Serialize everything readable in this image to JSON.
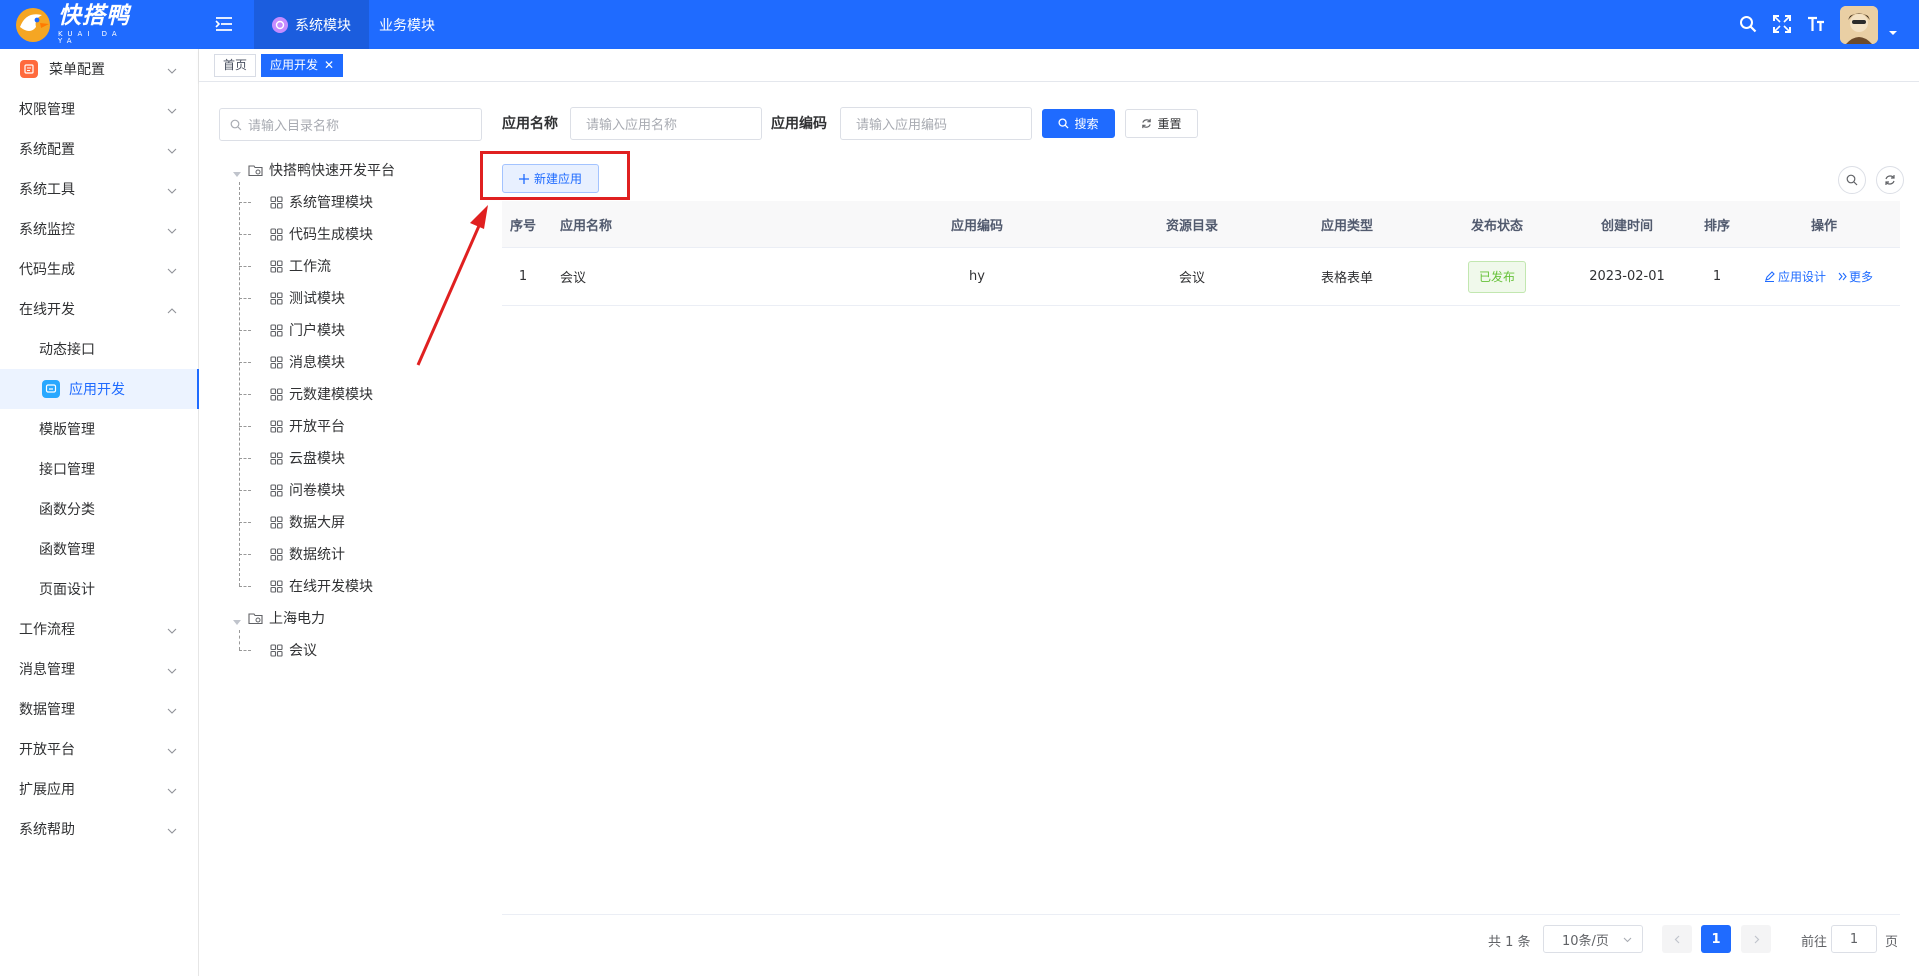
{
  "colors": {
    "primary": "#1f6bff",
    "annotation": "#e02020",
    "published": "#67c23a"
  },
  "header": {
    "logo_name": "快搭鸭",
    "logo_sub": "KUAI DA YA",
    "tabs": [
      {
        "label": "系统模块",
        "active": true
      },
      {
        "label": "业务模块",
        "active": false
      }
    ],
    "icons": [
      "search-icon",
      "fullscreen-icon",
      "font-size-icon",
      "avatar"
    ]
  },
  "sidebar": {
    "items": [
      {
        "label": "菜单配置",
        "icon": "menu-config-icon",
        "expandable": true
      },
      {
        "label": "权限管理",
        "expandable": true
      },
      {
        "label": "系统配置",
        "expandable": true
      },
      {
        "label": "系统工具",
        "expandable": true
      },
      {
        "label": "系统监控",
        "expandable": true
      },
      {
        "label": "代码生成",
        "expandable": true
      },
      {
        "label": "在线开发",
        "expandable": true,
        "expanded": true
      },
      {
        "label": "动态接口",
        "sub": true
      },
      {
        "label": "应用开发",
        "sub": true,
        "active": true,
        "icon": "app-dev-icon"
      },
      {
        "label": "模版管理",
        "sub": true
      },
      {
        "label": "接口管理",
        "sub": true
      },
      {
        "label": "函数分类",
        "sub": true
      },
      {
        "label": "函数管理",
        "sub": true
      },
      {
        "label": "页面设计",
        "sub": true
      },
      {
        "label": "工作流程",
        "expandable": true
      },
      {
        "label": "消息管理",
        "expandable": true
      },
      {
        "label": "数据管理",
        "expandable": true
      },
      {
        "label": "开放平台",
        "expandable": true
      },
      {
        "label": "扩展应用",
        "expandable": true
      },
      {
        "label": "系统帮助",
        "expandable": true
      }
    ]
  },
  "tags": [
    {
      "label": "首页",
      "active": false
    },
    {
      "label": "应用开发",
      "active": true,
      "closable": "✕"
    }
  ],
  "tree": {
    "search_placeholder": "请输入目录名称",
    "roots": [
      {
        "label": "快搭鸭快速开发平台",
        "children": [
          "系统管理模块",
          "代码生成模块",
          "工作流",
          "测试模块",
          "门户模块",
          "消息模块",
          "元数建模模块",
          "开放平台",
          "云盘模块",
          "问卷模块",
          "数据大屏",
          "数据统计",
          "在线开发模块"
        ]
      },
      {
        "label": "上海电力",
        "children": [
          "会议"
        ]
      }
    ]
  },
  "filters": {
    "app_name_label": "应用名称",
    "app_name_placeholder": "请输入应用名称",
    "app_code_label": "应用编码",
    "app_code_placeholder": "请输入应用编码",
    "search_button": "搜索",
    "reset_button": "重置"
  },
  "toolbar": {
    "new_button": "新建应用"
  },
  "table": {
    "columns": [
      "序号",
      "应用名称",
      "应用编码",
      "资源目录",
      "应用类型",
      "发布状态",
      "创建时间",
      "排序",
      "操作"
    ],
    "rows": [
      {
        "index": "1",
        "name": "会议",
        "code": "hy",
        "dir": "会议",
        "type": "表格表单",
        "status": "已发布",
        "created": "2023-02-01",
        "sort": "1",
        "op_design": "应用设计",
        "op_more": "更多"
      }
    ]
  },
  "pager": {
    "total": "共 1 条",
    "page_size": "10条/页",
    "current": "1",
    "goto_label": "前往",
    "goto_value": "1",
    "page_unit": "页"
  }
}
